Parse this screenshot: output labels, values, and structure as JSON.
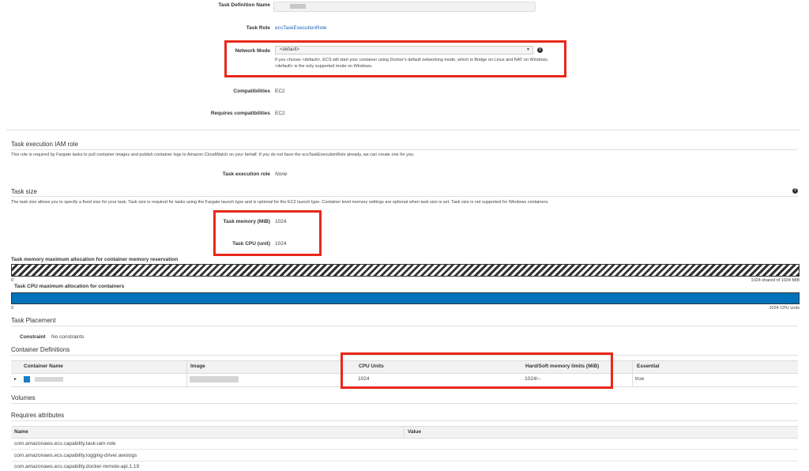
{
  "task_def": {
    "name_label": "Task Definition Name",
    "task_role_label": "Task Role",
    "task_role_value": "ecsTaskExecutionRole",
    "network_mode_label": "Network Mode",
    "network_mode_value": "<default>",
    "network_mode_help": "If you choose <default>, ECS will start your container using Docker's default networking mode, which is Bridge on Linux and NAT on Windows. <default> is the only supported mode on Windows.",
    "compat_label": "Compatibilities",
    "compat_value": "EC2",
    "req_compat_label": "Requires compatibilities",
    "req_compat_value": "EC2"
  },
  "iam": {
    "title": "Task execution IAM role",
    "desc": "This role is required by Fargate tasks to pull container images and publish container logs to Amazon CloudWatch on your behalf. If you do not have the ecsTaskExecutionRole already, we can create one for you.",
    "role_label": "Task execution role",
    "role_value": "None"
  },
  "size": {
    "title": "Task size",
    "desc": "The task size allows you to specify a fixed size for your task. Task size is required for tasks using the Fargate launch type and is optional for the EC2 launch type. Container level memory settings are optional when task size is set. Task size is not supported for Windows containers.",
    "memory_label": "Task memory (MiB)",
    "memory_value": "1024",
    "cpu_label": "Task CPU (unit)",
    "cpu_value": "1024"
  },
  "alloc": {
    "mem_title": "Task memory maximum allocation for container memory reservation",
    "mem_min": "0",
    "mem_right": "1024 shared of 1024 MiB",
    "mem_fraction": 1.0,
    "cpu_title": "Task CPU maximum allocation for containers",
    "cpu_min": "0",
    "cpu_right": "1024 CPU units",
    "cpu_fraction": 1.0
  },
  "placement": {
    "title": "Task Placement",
    "constraint_label": "Constraint",
    "constraint_value": "No constraints"
  },
  "containers": {
    "title": "Container Definitions",
    "headers": [
      "Container Name",
      "Image",
      "CPU Units",
      "Hard/Soft memory limits (MiB)",
      "Essential"
    ],
    "row": {
      "cpu": "1024",
      "memory": "1024/--",
      "essential": "true"
    }
  },
  "volumes": {
    "title": "Volumes"
  },
  "attributes": {
    "title": "Requires attributes",
    "headers": [
      "Name",
      "Value"
    ],
    "rows": [
      "com.amazonaws.ecs.capability.task-iam-role",
      "com.amazonaws.ecs.capability.logging-driver.awslogs",
      "com.amazonaws.ecs.capability.docker-remote-api.1.19"
    ]
  },
  "icons": {
    "info": "info-icon",
    "help": "help-icon",
    "expand": "caret-right-icon"
  },
  "colors": {
    "highlight": "#e8281a",
    "cpu_bar": "#0073bb",
    "link": "#1a65b5"
  }
}
